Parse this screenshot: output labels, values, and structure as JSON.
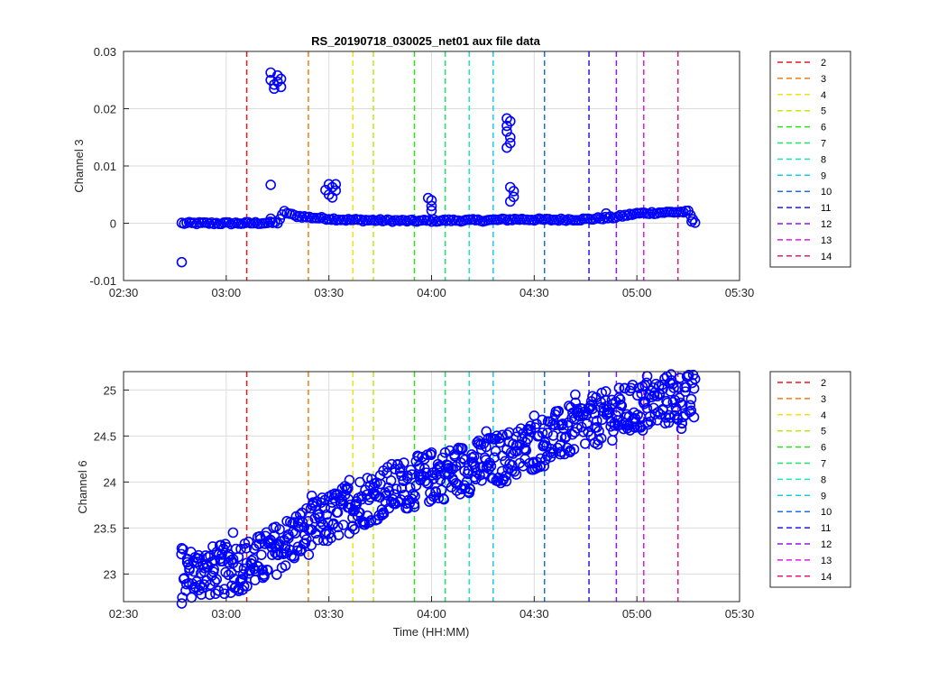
{
  "chart_data": [
    {
      "type": "scatter",
      "title": "RS_20190718_030025_net01 aux file data",
      "xlabel": "",
      "ylabel": "Channel 3",
      "xlim": [
        "02:30",
        "05:30"
      ],
      "ylim": [
        -0.01,
        0.03
      ],
      "xticks": [
        "02:30",
        "03:00",
        "03:30",
        "04:00",
        "04:30",
        "05:00",
        "05:30"
      ],
      "yticks": [
        "-0.01",
        "0",
        "0.01",
        "0.02",
        "0.03"
      ],
      "grid": true,
      "legend_placement": "outside-right",
      "marker": "circle",
      "marker_color": "#0000ff",
      "vlines": [
        {
          "name": "2",
          "x": "03:06",
          "color": "#e8191b"
        },
        {
          "name": "3",
          "x": "03:24",
          "color": "#f07d0f"
        },
        {
          "name": "4",
          "x": "03:37",
          "color": "#f2e20f"
        },
        {
          "name": "5",
          "x": "03:43",
          "color": "#b9ec0c"
        },
        {
          "name": "6",
          "x": "03:55",
          "color": "#2ae41b"
        },
        {
          "name": "7",
          "x": "04:04",
          "color": "#14ea61"
        },
        {
          "name": "8",
          "x": "04:11",
          "color": "#14eabf"
        },
        {
          "name": "9",
          "x": "04:18",
          "color": "#17cbe8"
        },
        {
          "name": "10",
          "x": "04:33",
          "color": "#1c6ce8"
        },
        {
          "name": "11",
          "x": "04:46",
          "color": "#2317e8"
        },
        {
          "name": "12",
          "x": "04:54",
          "color": "#8d17e8"
        },
        {
          "name": "13",
          "x": "05:02",
          "color": "#e117e8"
        },
        {
          "name": "14",
          "x": "05:12",
          "color": "#e8177d"
        }
      ],
      "series": [
        {
          "points": [
            [
              "02:47",
              -0.0068
            ],
            [
              "03:13",
              0.0067
            ],
            [
              "03:13",
              0.0008
            ],
            [
              "03:13",
              0.0263
            ],
            [
              "03:13",
              0.025
            ],
            [
              "03:14",
              0.0242
            ],
            [
              "03:14",
              0.0235
            ],
            [
              "03:15",
              0.0258
            ],
            [
              "03:15",
              0.0247
            ],
            [
              "03:16",
              0.0238
            ],
            [
              "03:16",
              0.0252
            ],
            [
              "03:29",
              0.0058
            ],
            [
              "03:30",
              0.0068
            ],
            [
              "03:30",
              0.005
            ],
            [
              "03:31",
              0.0063
            ],
            [
              "03:32",
              0.0057
            ],
            [
              "03:31",
              0.0045
            ],
            [
              "03:32",
              0.0068
            ],
            [
              "03:59",
              0.0044
            ],
            [
              "04:00",
              0.004
            ],
            [
              "04:00",
              0.003
            ],
            [
              "04:00",
              0.0022
            ],
            [
              "04:22",
              0.0183
            ],
            [
              "04:22",
              0.017
            ],
            [
              "04:22",
              0.016
            ],
            [
              "04:23",
              0.015
            ],
            [
              "04:23",
              0.014
            ],
            [
              "04:22",
              0.0132
            ],
            [
              "04:23",
              0.0178
            ],
            [
              "04:23",
              0.0063
            ],
            [
              "04:24",
              0.0056
            ],
            [
              "04:24",
              0.0046
            ],
            [
              "04:23",
              0.0038
            ],
            [
              "04:51",
              0.0017
            ],
            [
              "05:16",
              0.0003
            ],
            [
              "05:17",
              0.0001
            ]
          ],
          "baseline_points": [
            [
              "02:47",
              0.0
            ],
            [
              "02:55",
              0.0
            ],
            [
              "03:05",
              0.0
            ],
            [
              "03:15",
              0.0001
            ],
            [
              "03:17",
              0.002
            ],
            [
              "03:20",
              0.0013
            ],
            [
              "03:25",
              0.001
            ],
            [
              "03:35",
              0.0006
            ],
            [
              "03:45",
              0.0005
            ],
            [
              "03:55",
              0.0004
            ],
            [
              "04:05",
              0.0005
            ],
            [
              "04:15",
              0.0005
            ],
            [
              "04:25",
              0.0007
            ],
            [
              "04:35",
              0.0006
            ],
            [
              "04:45",
              0.0007
            ],
            [
              "04:53",
              0.001
            ],
            [
              "05:00",
              0.0017
            ],
            [
              "05:08",
              0.0019
            ],
            [
              "05:15",
              0.002
            ],
            [
              "05:17",
              0.0001
            ]
          ]
        }
      ]
    },
    {
      "type": "scatter",
      "title": "",
      "xlabel": "Time (HH:MM)",
      "ylabel": "Channel 6",
      "xlim": [
        "02:30",
        "05:30"
      ],
      "ylim": [
        22.7,
        25.2
      ],
      "xticks": [
        "02:30",
        "03:00",
        "03:30",
        "04:00",
        "04:30",
        "05:00",
        "05:30"
      ],
      "yticks": [
        "23",
        "23.5",
        "24",
        "24.5",
        "25"
      ],
      "grid": true,
      "legend_placement": "outside-right",
      "marker": "circle",
      "marker_color": "#0000ff",
      "vlines": [
        {
          "name": "2",
          "x": "03:06",
          "color": "#e8191b"
        },
        {
          "name": "3",
          "x": "03:24",
          "color": "#f07d0f"
        },
        {
          "name": "4",
          "x": "03:37",
          "color": "#f2e20f"
        },
        {
          "name": "5",
          "x": "03:43",
          "color": "#b9ec0c"
        },
        {
          "name": "6",
          "x": "03:55",
          "color": "#2ae41b"
        },
        {
          "name": "7",
          "x": "04:04",
          "color": "#14ea61"
        },
        {
          "name": "8",
          "x": "04:11",
          "color": "#14eabf"
        },
        {
          "name": "9",
          "x": "04:18",
          "color": "#17cbe8"
        },
        {
          "name": "10",
          "x": "04:33",
          "color": "#1c6ce8"
        },
        {
          "name": "11",
          "x": "04:46",
          "color": "#2317e8"
        },
        {
          "name": "12",
          "x": "04:54",
          "color": "#8d17e8"
        },
        {
          "name": "13",
          "x": "05:02",
          "color": "#e117e8"
        },
        {
          "name": "14",
          "x": "05:12",
          "color": "#e8177d"
        }
      ],
      "series": [
        {
          "trend": [
            [
              "02:47",
              23.0
            ],
            [
              "03:00",
              23.05
            ],
            [
              "03:10",
              23.15
            ],
            [
              "03:20",
              23.4
            ],
            [
              "03:30",
              23.6
            ],
            [
              "03:40",
              23.8
            ],
            [
              "03:50",
              23.95
            ],
            [
              "04:00",
              24.05
            ],
            [
              "04:10",
              24.15
            ],
            [
              "04:20",
              24.25
            ],
            [
              "04:30",
              24.4
            ],
            [
              "04:40",
              24.55
            ],
            [
              "04:50",
              24.7
            ],
            [
              "05:00",
              24.8
            ],
            [
              "05:10",
              24.9
            ],
            [
              "05:17",
              24.9
            ]
          ],
          "spread": 0.28,
          "extremes": [
            [
              "02:47",
              22.68
            ],
            [
              "02:47",
              23.28
            ],
            [
              "03:02",
              23.45
            ],
            [
              "03:25",
              23.85
            ],
            [
              "03:36",
              24.02
            ],
            [
              "04:00",
              24.32
            ],
            [
              "04:16",
              24.55
            ],
            [
              "04:30",
              24.72
            ],
            [
              "04:42",
              24.95
            ],
            [
              "05:03",
              25.15
            ],
            [
              "05:10",
              25.17
            ],
            [
              "05:17",
              25.12
            ],
            [
              "05:13",
              24.58
            ]
          ]
        }
      ]
    }
  ]
}
